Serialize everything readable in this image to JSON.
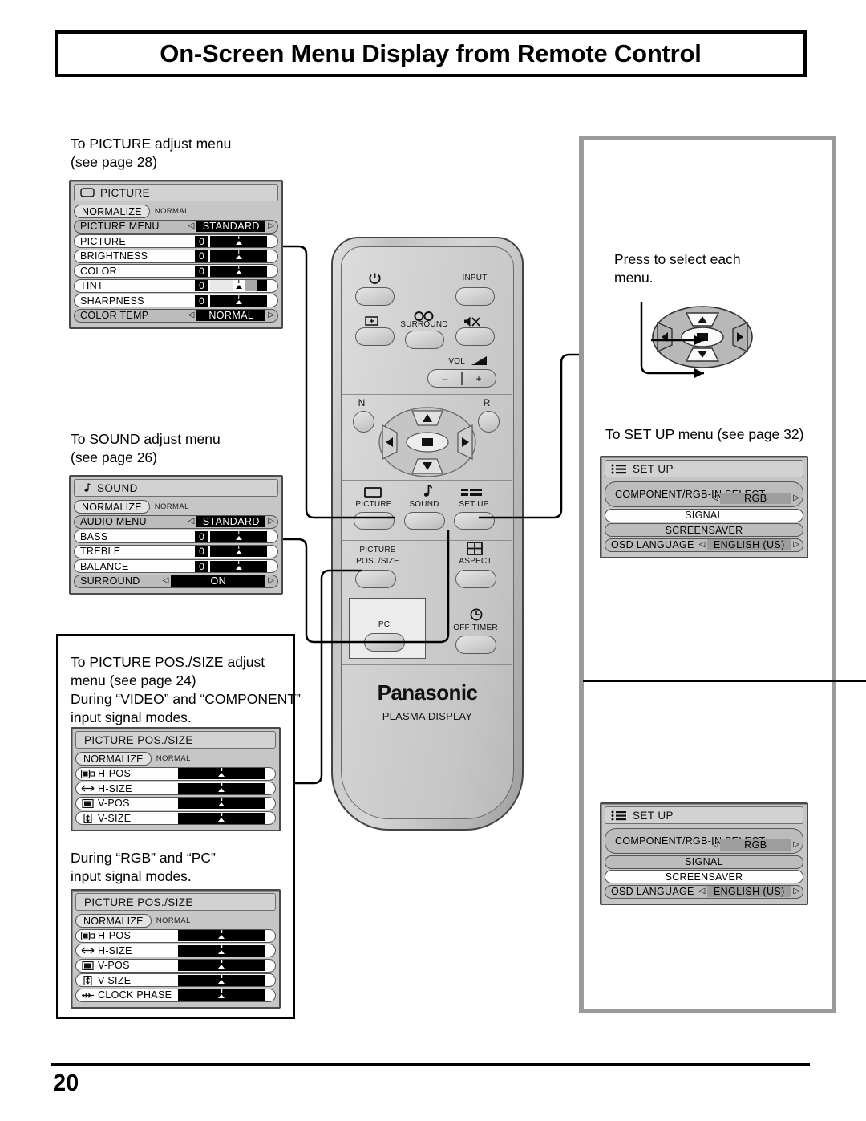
{
  "page": {
    "title": "On-Screen Menu Display from Remote Control",
    "number": "20"
  },
  "captions": {
    "picture": "To PICTURE adjust menu\n(see page 28)",
    "sound": "To SOUND adjust menu\n(see page 26)",
    "pos_size_video": "To PICTURE POS./SIZE adjust\nmenu (see page 24)\nDuring “VIDEO” and “COMPONENT”\ninput signal modes.",
    "pos_size_rgb": "During “RGB” and “PC”\ninput signal modes.",
    "press_select": "Press to select each\nmenu.",
    "setup": "To SET UP menu (see page 32)"
  },
  "osd": {
    "normalize_label": "NORMALIZE",
    "normalize_value": "NORMAL",
    "picture": {
      "header": "PICTURE",
      "header_icon": "screen-icon",
      "rows": [
        {
          "label": "PICTURE  MENU",
          "type": "select",
          "value": "STANDARD"
        },
        {
          "label": "PICTURE",
          "type": "number",
          "value": "0"
        },
        {
          "label": "BRIGHTNESS",
          "type": "number",
          "value": "0"
        },
        {
          "label": "COLOR",
          "type": "number",
          "value": "0"
        },
        {
          "label": "TINT",
          "type": "number",
          "value": "0",
          "bar": "tint"
        },
        {
          "label": "SHARPNESS",
          "type": "number",
          "value": "0"
        },
        {
          "label": "COLOR  TEMP",
          "type": "select",
          "value": "NORMAL"
        }
      ]
    },
    "sound": {
      "header": "SOUND",
      "header_icon": "music-note-icon",
      "rows": [
        {
          "label": "AUDIO  MENU",
          "type": "select",
          "value": "STANDARD"
        },
        {
          "label": "BASS",
          "type": "number",
          "value": "0"
        },
        {
          "label": "TREBLE",
          "type": "number",
          "value": "0"
        },
        {
          "label": "BALANCE",
          "type": "number",
          "value": "0"
        },
        {
          "label": "SURROUND",
          "type": "select",
          "value": "ON"
        }
      ]
    },
    "possize_video": {
      "header": "PICTURE  POS./SIZE",
      "rows": [
        {
          "label": "H-POS",
          "icon": "h-pos-icon"
        },
        {
          "label": "H-SIZE",
          "icon": "h-size-icon"
        },
        {
          "label": "V-POS",
          "icon": "v-pos-icon"
        },
        {
          "label": "V-SIZE",
          "icon": "v-size-icon"
        }
      ]
    },
    "possize_rgb": {
      "header": "PICTURE  POS./SIZE",
      "rows": [
        {
          "label": "H-POS",
          "icon": "h-pos-icon"
        },
        {
          "label": "H-SIZE",
          "icon": "h-size-icon"
        },
        {
          "label": "V-POS",
          "icon": "v-pos-icon"
        },
        {
          "label": "V-SIZE",
          "icon": "v-size-icon"
        },
        {
          "label": "CLOCK  PHASE",
          "icon": "clock-phase-icon"
        }
      ]
    },
    "setup_top": {
      "header": "SET UP",
      "header_icon": "setup-list-icon",
      "component_label": "COMPONENT/RGB-IN  SELECT",
      "component_value": "RGB",
      "signal_label": "SIGNAL",
      "screensaver_label": "SCREENSAVER",
      "osd_language_label": "OSD  LANGUAGE",
      "osd_language_value": "ENGLISH (US)"
    },
    "setup_bottom": {
      "header": "SET UP",
      "header_icon": "setup-list-icon",
      "component_label": "COMPONENT/RGB-IN  SELECT",
      "component_value": "RGB",
      "signal_label": "SIGNAL",
      "screensaver_label": "SCREENSAVER",
      "osd_language_label": "OSD  LANGUAGE",
      "osd_language_value": "ENGLISH (US)"
    }
  },
  "remote": {
    "brand": "Panasonic",
    "subbrand": "PLASMA DISPLAY",
    "labels": {
      "power": "",
      "input": "INPUT",
      "surround": "SURROUND",
      "mute": "",
      "recall": "",
      "vol": "VOL",
      "vol_minus": "–",
      "vol_plus": "+",
      "n": "N",
      "r": "R",
      "picture": "PICTURE",
      "sound": "SOUND",
      "setup": "SET UP",
      "picture_pos_size_1": "PICTURE",
      "picture_pos_size_2": "POS. /SIZE",
      "aspect": "ASPECT",
      "pc": "PC",
      "off_timer": "OFF TIMER"
    }
  },
  "colors": {
    "osd_bg": "#c6c6c6",
    "osd_row": "#d8d8d8",
    "osd_selected": "#000000",
    "frame_grey": "#9a9a9a",
    "ink": "#000000"
  }
}
